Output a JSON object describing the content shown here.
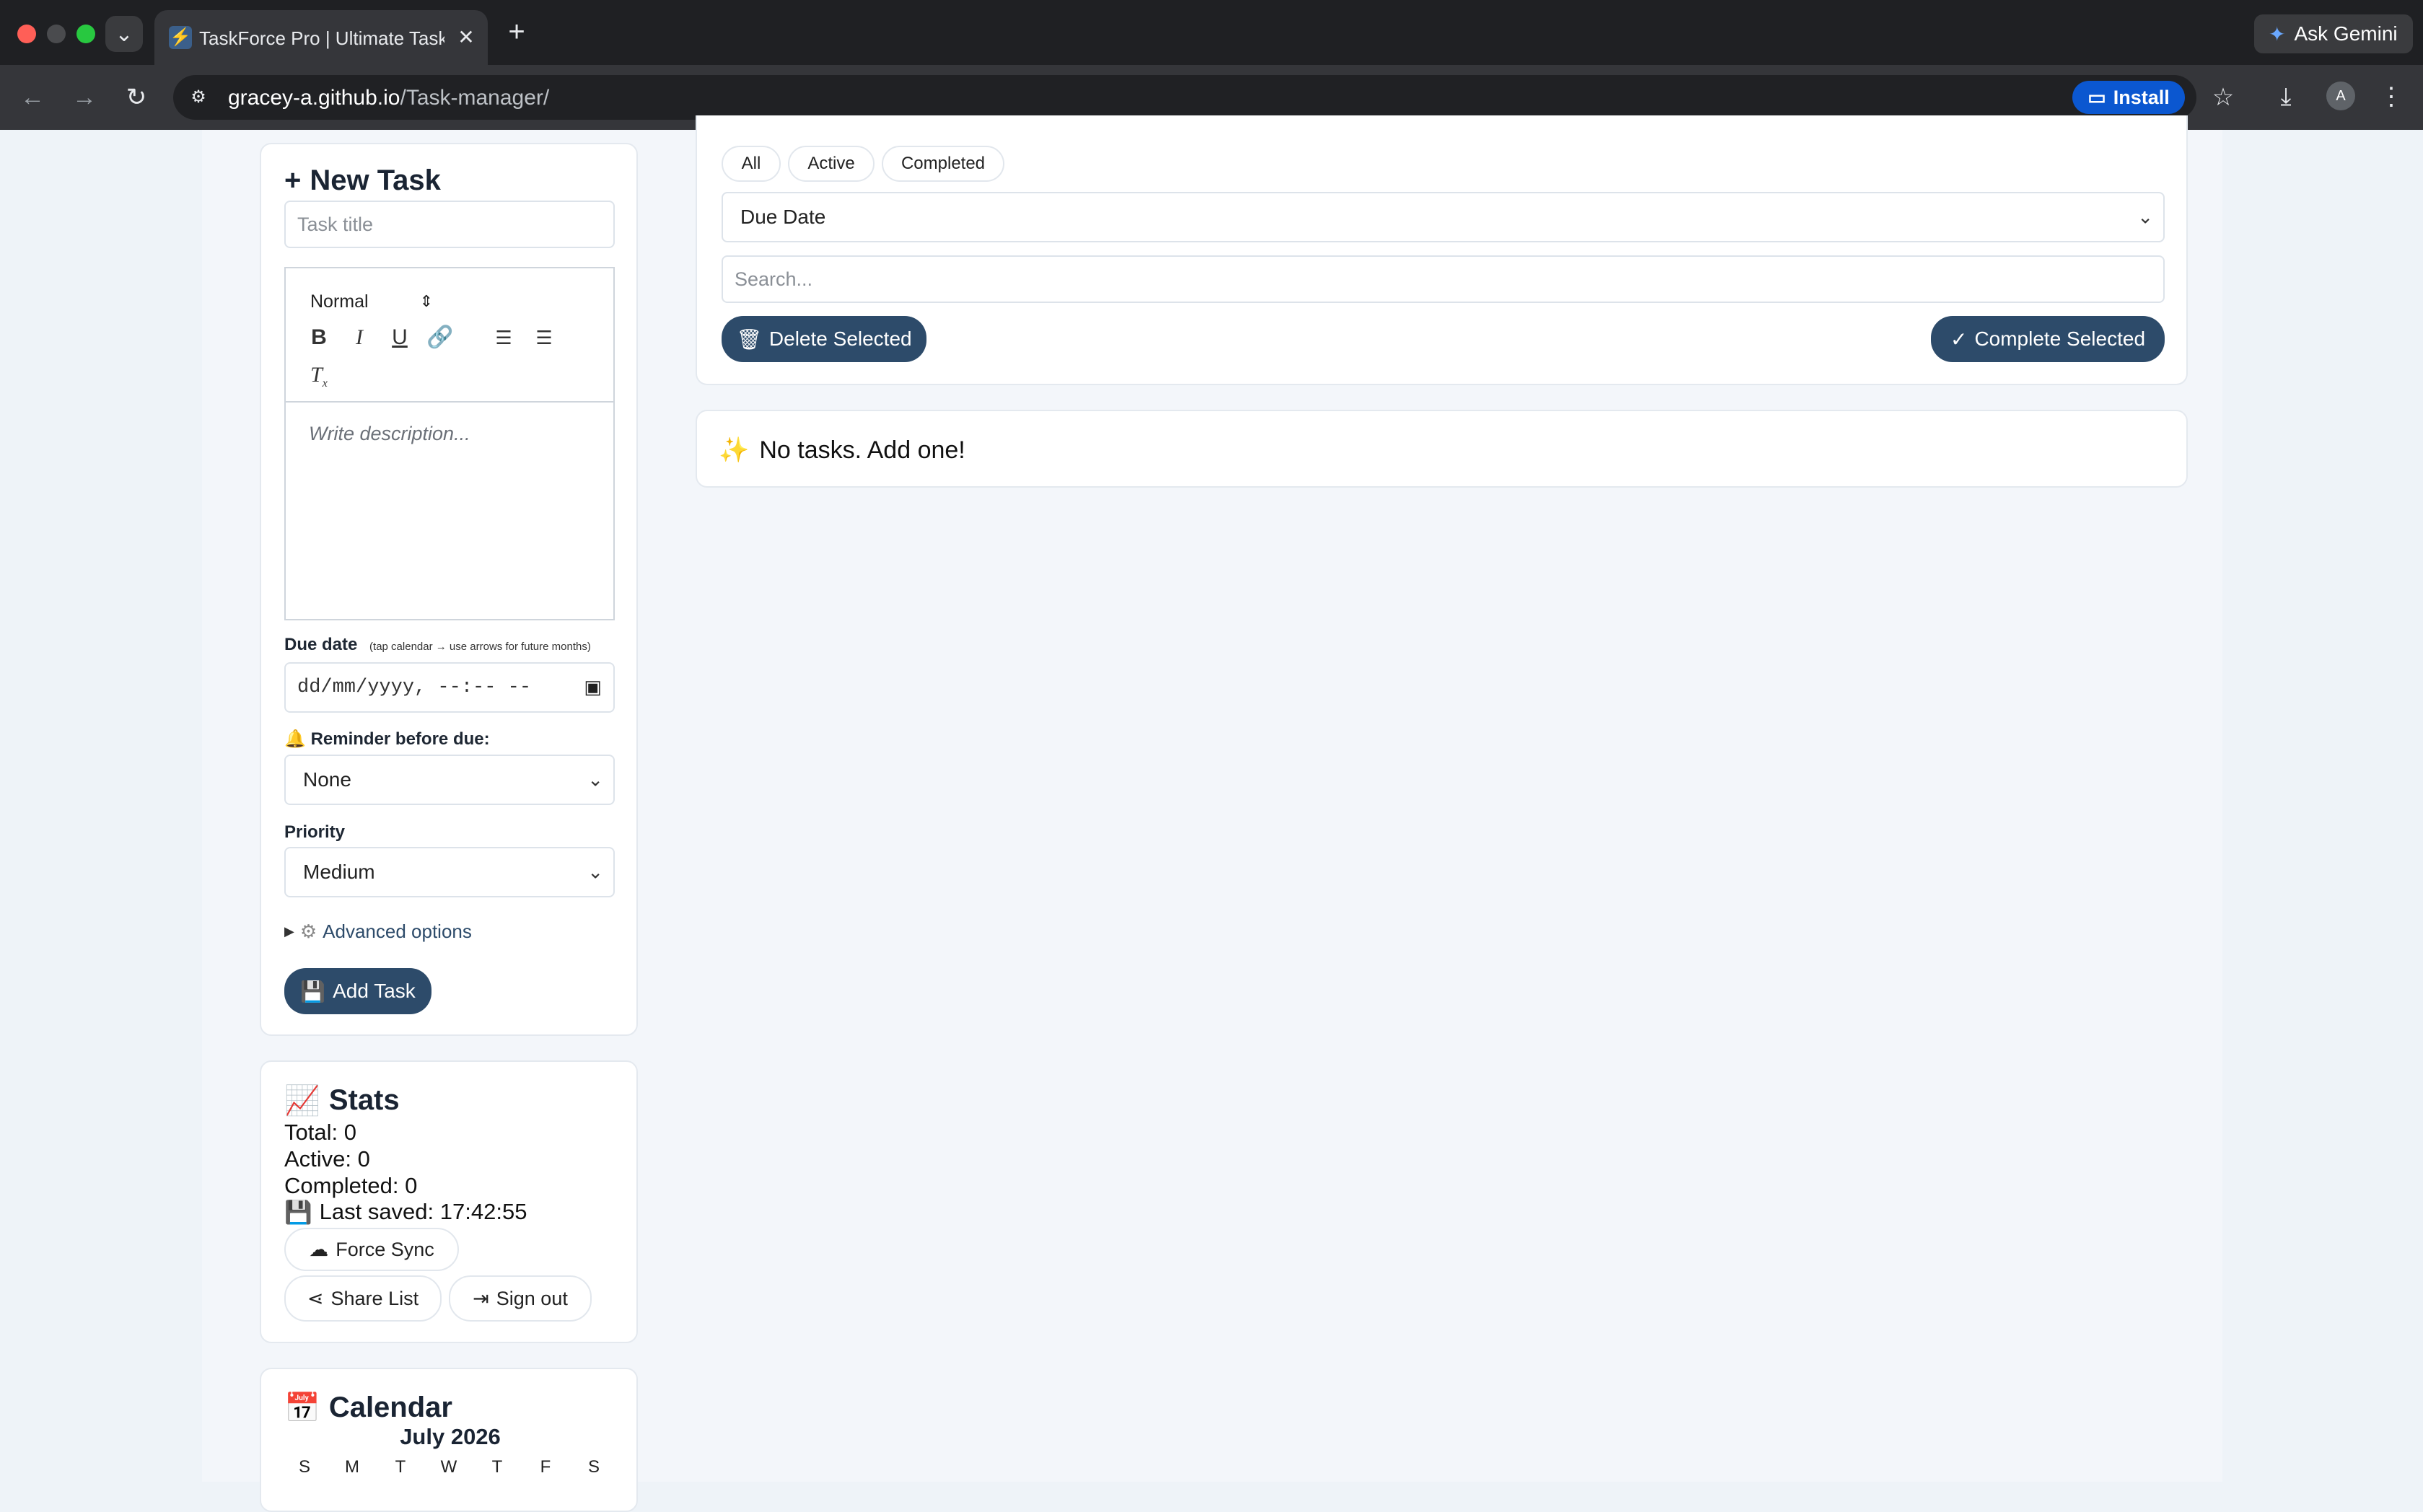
{
  "browser": {
    "tab_title": "TaskForce Pro | Ultimate Task",
    "tab_favicon": "⚡",
    "new_tab_icon": "+",
    "ask_gemini": "Ask Gemini",
    "url_host": "gracey-a.github.io",
    "url_path": "/Task-manager/",
    "install_label": "Install",
    "avatar_letter": "A"
  },
  "filters": {
    "tabs": [
      "All",
      "Active",
      "Completed"
    ],
    "sort_value": "Due Date",
    "search_placeholder": "Search...",
    "delete_selected": "Delete Selected",
    "complete_selected": "Complete Selected"
  },
  "task_list": {
    "empty_message": "No tasks. Add one!",
    "empty_icon": "✨"
  },
  "new_task": {
    "heading": "New Task",
    "title_placeholder": "Task title",
    "format_value": "Normal",
    "description_placeholder": "Write description...",
    "due_label": "Due date",
    "due_hint": "(tap calendar → use arrows for future months)",
    "due_placeholder": "dd/mm/yyyy, --:-- --",
    "reminder_label": "Reminder before due:",
    "reminder_value": "None",
    "priority_label": "Priority",
    "priority_value": "Medium",
    "advanced_label": "Advanced options",
    "add_button": "Add Task"
  },
  "stats": {
    "heading": "Stats",
    "total": "Total: 0",
    "active": "Active: 0",
    "completed": "Completed: 0",
    "last_saved": "Last saved: 17:42:55",
    "force_sync": "Force Sync",
    "share_list": "Share List",
    "sign_out": "Sign out"
  },
  "calendar": {
    "heading": "Calendar",
    "month": "July 2026",
    "weekdays": [
      "S",
      "M",
      "T",
      "W",
      "T",
      "F",
      "S"
    ]
  },
  "colors": {
    "primary": "#2d4b6a",
    "page_bg": "#eef3f8",
    "card_border": "#e4e9ef"
  }
}
